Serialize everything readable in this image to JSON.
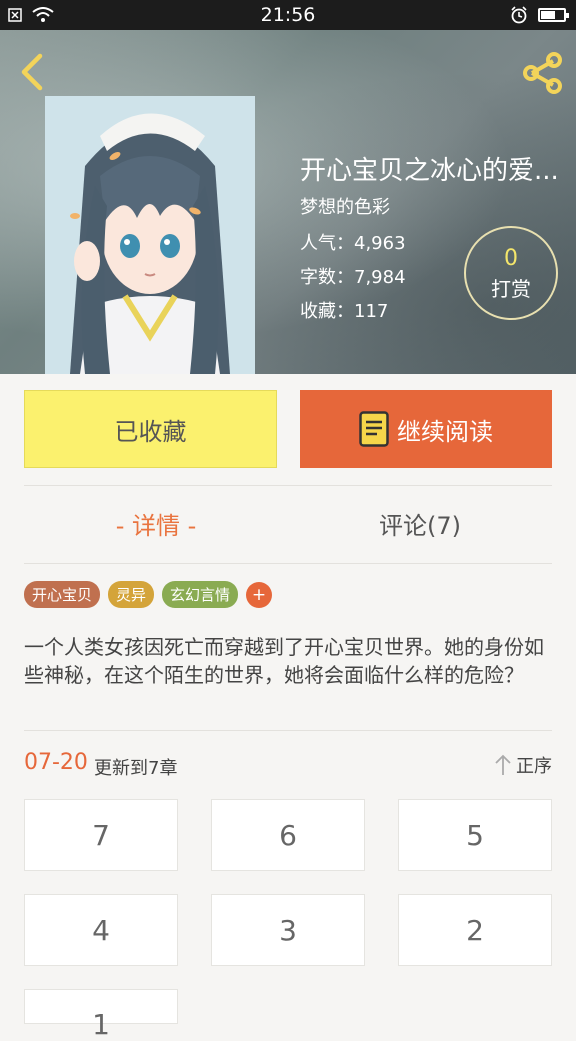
{
  "status_bar": {
    "time": "21:56",
    "icons": [
      "notification-icon",
      "wifi-icon",
      "alarm-icon",
      "battery-icon"
    ]
  },
  "book": {
    "title": "开心宝贝之冰心的爱...",
    "author": "梦想的色彩",
    "popularity": "人气：4,963",
    "word_count": "字数：7,984",
    "favorites": "收藏：117"
  },
  "tip": {
    "count": "0",
    "label": "打赏"
  },
  "actions": {
    "collected": "已收藏",
    "continue_reading": "继续阅读"
  },
  "tabs": {
    "detail": "- 详情 -",
    "comments": "评论(7)"
  },
  "tags": [
    {
      "label": "开心宝贝",
      "color": "#c0704f"
    },
    {
      "label": "灵异",
      "color": "#d4a43a"
    },
    {
      "label": "玄幻言情",
      "color": "#8aab52"
    }
  ],
  "tag_add": "+",
  "description": "一个人类女孩因死亡而穿越到了开心宝贝世界。她的身份如些神秘，在这个陌生的世界，她将会面临什么样的危险？",
  "update": {
    "date": "07-20",
    "text": "更新到7章",
    "sort_label": "正序"
  },
  "chapters": [
    "7",
    "6",
    "5",
    "4",
    "3",
    "2",
    "1"
  ],
  "colors": {
    "accent": "#e6673a",
    "collected_bg": "#fbf16e",
    "tip_count": "#f4e66b"
  }
}
